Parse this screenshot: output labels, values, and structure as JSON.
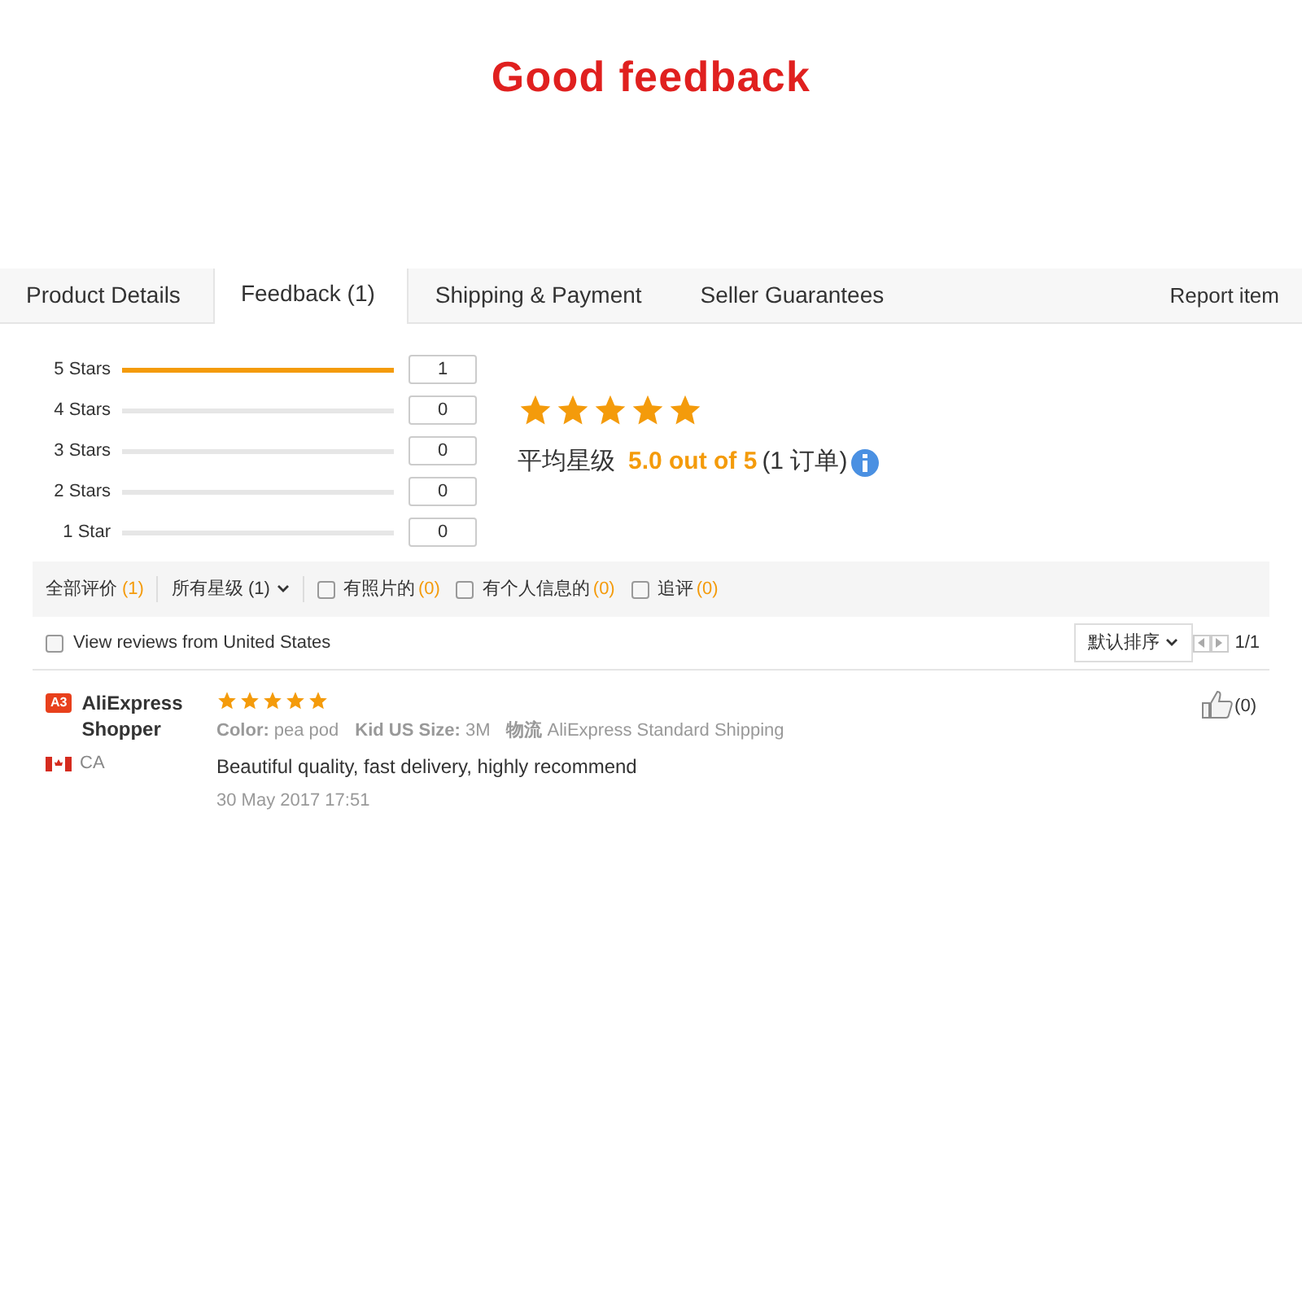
{
  "title": "Good feedback",
  "tabs": [
    {
      "label": "Product Details",
      "selected": false
    },
    {
      "label": "Feedback (1)",
      "selected": true
    },
    {
      "label": "Shipping & Payment",
      "selected": false
    },
    {
      "label": "Seller Guarantees",
      "selected": false
    }
  ],
  "report_link": "Report item",
  "histogram": [
    {
      "label": "5 Stars",
      "level": 1,
      "count": "1"
    },
    {
      "label": "4 Stars",
      "level": 0,
      "count": "0"
    },
    {
      "label": "3 Stars",
      "level": 0,
      "count": "0"
    },
    {
      "label": "2 Stars",
      "level": 0,
      "count": "0"
    },
    {
      "label": "1 Star",
      "level": 0,
      "count": "0"
    }
  ],
  "summary": {
    "stars": 5,
    "label": "平均星级",
    "score": "5.0 out of 5",
    "orders": "(1 订单)"
  },
  "filters": [
    {
      "kind": "link",
      "label": "全部评价",
      "count": "(1)"
    },
    {
      "kind": "dropdown",
      "label": "所有星级 (1)"
    },
    {
      "kind": "checkbox",
      "label": "有照片的",
      "count": "(0)",
      "checked": false
    },
    {
      "kind": "checkbox",
      "label": "有个人信息的",
      "count": "(0)",
      "checked": false
    },
    {
      "kind": "checkbox",
      "label": "追评",
      "count": "(0)",
      "checked": false
    }
  ],
  "country_filter": {
    "label": "View reviews from United States",
    "checked": false
  },
  "sort": {
    "label": "默认排序"
  },
  "pagination": "1/1",
  "reviews": [
    {
      "badge": "A3",
      "name": "AliExpress Shopper",
      "country": "CA",
      "stars": 5,
      "attributes": [
        {
          "label": "Color:",
          "value": "pea pod"
        },
        {
          "label": "Kid US Size:",
          "value": "3M"
        },
        {
          "label": "物流",
          "value": "AliExpress Standard Shipping"
        }
      ],
      "text": "Beautiful quality, fast delivery, highly recommend",
      "date": "30 May 2017 17:51",
      "likes": "(0)"
    }
  ]
}
